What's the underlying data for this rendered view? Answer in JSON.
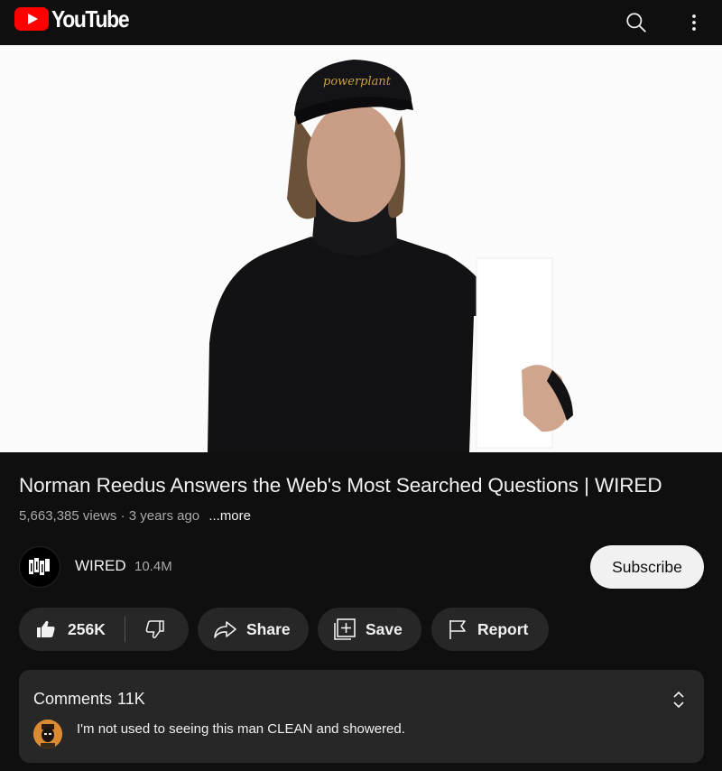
{
  "app": {
    "name": "YouTube"
  },
  "header": {
    "logo_text": "YouTube",
    "icons": [
      "search-icon",
      "more-vert-icon"
    ]
  },
  "video": {
    "title": "Norman Reedus Answers the Web's Most Searched Questions | WIRED",
    "views": "5,663,385 views",
    "age": "3 years ago",
    "more_label": "...more"
  },
  "channel": {
    "name": "WIRED",
    "subscribers": "10.4M",
    "subscribe_label": "Subscribe"
  },
  "actions": {
    "likes": "256K",
    "share_label": "Share",
    "save_label": "Save",
    "report_label": "Report"
  },
  "comments": {
    "label": "Comments",
    "count": "11K",
    "top_comment": "I'm not used to seeing this man CLEAN and showered."
  },
  "colors": {
    "brand_red": "#ff0000",
    "background": "#0f0f0f",
    "surface": "#272727",
    "text_secondary": "#aaaaaa"
  }
}
